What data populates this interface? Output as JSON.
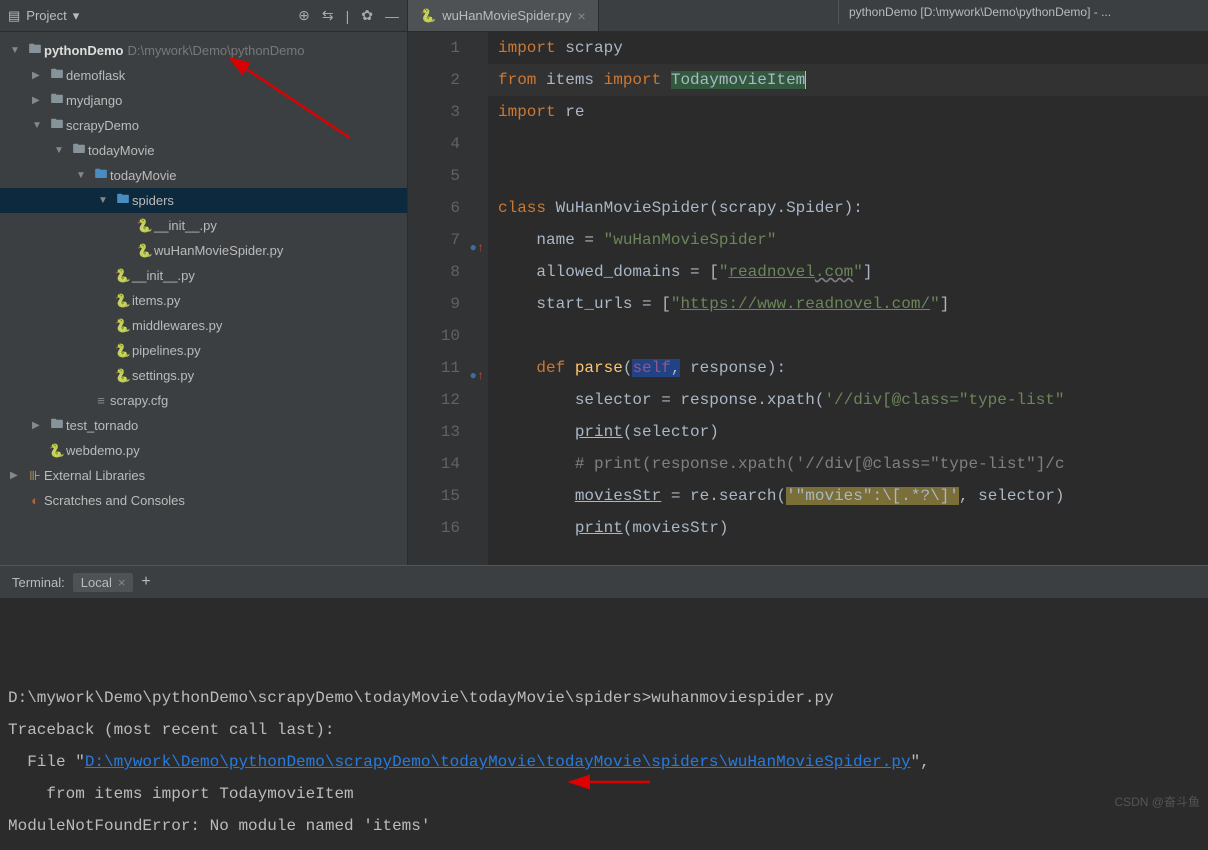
{
  "window_title": "pythonDemo [D:\\mywork\\Demo\\pythonDemo] - ...",
  "sidebar": {
    "title": "Project",
    "tree": [
      {
        "indent": 0,
        "arrow": "▼",
        "icon": "folder",
        "label": "pythonDemo",
        "path": "D:\\mywork\\Demo\\pythonDemo",
        "bold": true
      },
      {
        "indent": 1,
        "arrow": "▶",
        "icon": "folder",
        "label": "demoflask"
      },
      {
        "indent": 1,
        "arrow": "▶",
        "icon": "folder",
        "label": "mydjango"
      },
      {
        "indent": 1,
        "arrow": "▼",
        "icon": "folder",
        "label": "scrapyDemo"
      },
      {
        "indent": 2,
        "arrow": "▼",
        "icon": "folder",
        "label": "todayMovie"
      },
      {
        "indent": 3,
        "arrow": "▼",
        "icon": "folder-blue",
        "label": "todayMovie"
      },
      {
        "indent": 4,
        "arrow": "▼",
        "icon": "folder-blue",
        "label": "spiders",
        "selected": true
      },
      {
        "indent": 5,
        "arrow": "",
        "icon": "py",
        "label": "__init__.py"
      },
      {
        "indent": 5,
        "arrow": "",
        "icon": "py",
        "label": "wuHanMovieSpider.py"
      },
      {
        "indent": 4,
        "arrow": "",
        "icon": "py",
        "label": "__init__.py"
      },
      {
        "indent": 4,
        "arrow": "",
        "icon": "py",
        "label": "items.py"
      },
      {
        "indent": 4,
        "arrow": "",
        "icon": "py",
        "label": "middlewares.py"
      },
      {
        "indent": 4,
        "arrow": "",
        "icon": "py",
        "label": "pipelines.py"
      },
      {
        "indent": 4,
        "arrow": "",
        "icon": "py",
        "label": "settings.py"
      },
      {
        "indent": 3,
        "arrow": "",
        "icon": "cfg",
        "label": "scrapy.cfg"
      },
      {
        "indent": 1,
        "arrow": "▶",
        "icon": "folder",
        "label": "test_tornado"
      },
      {
        "indent": 1,
        "arrow": "",
        "icon": "py",
        "label": "webdemo.py"
      },
      {
        "indent": 0,
        "arrow": "▶",
        "icon": "lib",
        "label": "External Libraries"
      },
      {
        "indent": 0,
        "arrow": "",
        "icon": "scratch",
        "label": "Scratches and Consoles"
      }
    ]
  },
  "tabs": [
    {
      "icon": "py",
      "label": "wuHanMovieSpider.py"
    }
  ],
  "code": {
    "lines": [
      "import scrapy",
      "from items import TodaymovieItem",
      "import re",
      "",
      "",
      "class WuHanMovieSpider(scrapy.Spider):",
      "    name = \"wuHanMovieSpider\"",
      "    allowed_domains = [\"readnovel.com\"]",
      "    start_urls = [\"https://www.readnovel.com/\"]",
      "",
      "    def parse(self, response):",
      "        selector = response.xpath('//div[@class=\"type-list\"",
      "        print(selector)",
      "        # print(response.xpath('//div[@class=\"type-list\"]/c",
      "        moviesStr = re.search('\"movies\":\\[.*?\\]', selector)",
      "        print(moviesStr)"
    ]
  },
  "terminal": {
    "title": "Terminal:",
    "tab": "Local",
    "lines": [
      {
        "t": "D:\\mywork\\Demo\\pythonDemo\\scrapyDemo\\todayMovie\\todayMovie\\spiders>wuhanmoviespider.py"
      },
      {
        "t": "Traceback (most recent call last):"
      },
      {
        "t": "  File \"",
        "link": "D:\\mywork\\Demo\\pythonDemo\\scrapyDemo\\todayMovie\\todayMovie\\spiders\\wuHanMovieSpider.py",
        "after": "\","
      },
      {
        "t": "    from items import TodaymovieItem"
      },
      {
        "t": "ModuleNotFoundError: No module named 'items'"
      }
    ]
  },
  "watermark": "CSDN @奋斗鱼"
}
